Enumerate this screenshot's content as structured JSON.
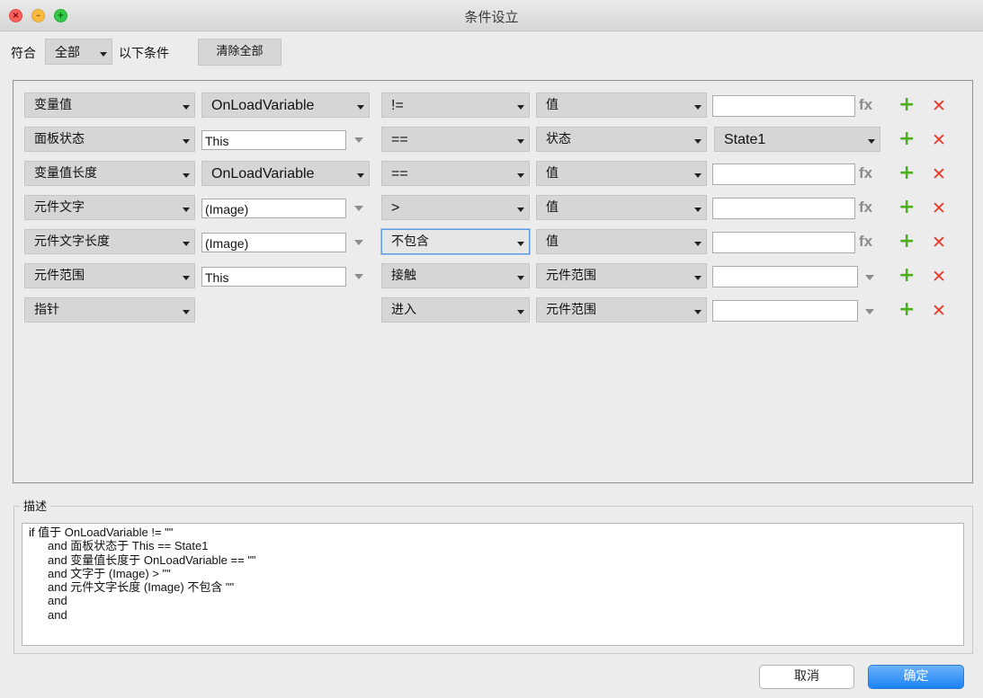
{
  "window": {
    "title": "条件设立"
  },
  "top": {
    "match_label": "符合",
    "match_value": "全部",
    "following_label": "以下条件",
    "clear_all": "清除全部"
  },
  "rows": [
    {
      "type": "变量值",
      "target": "OnLoadVariable",
      "op": "!=",
      "value_type": "值",
      "value": ""
    },
    {
      "type": "面板状态",
      "target": "This",
      "op": "==",
      "value_type": "状态",
      "value": "State1"
    },
    {
      "type": "变量值长度",
      "target": "OnLoadVariable",
      "op": "==",
      "value_type": "值",
      "value": ""
    },
    {
      "type": "元件文字",
      "target": "(Image)",
      "op": ">",
      "value_type": "值",
      "value": ""
    },
    {
      "type": "元件文字长度",
      "target": "(Image)",
      "op": "不包含",
      "value_type": "值",
      "value": ""
    },
    {
      "type": "元件范围",
      "target": "This",
      "op": "接触",
      "value_type": "元件范围",
      "value": ""
    },
    {
      "type": "指针",
      "target": "",
      "op": "进入",
      "value_type": "元件范围",
      "value": ""
    }
  ],
  "icons": {
    "fx": "fx",
    "plus": "+",
    "delete": "✕",
    "close": "×",
    "minimize": "–",
    "zoom": "+"
  },
  "description": {
    "label": "描述",
    "lines": [
      "if 值于 OnLoadVariable != \"\"",
      "and 面板状态于 This == State1",
      "and 变量值长度于 OnLoadVariable == \"\"",
      "and 文字于 (Image) > \"\"",
      "and 元件文字长度 (Image) 不包含 \"\"",
      "and",
      "and"
    ]
  },
  "buttons": {
    "cancel": "取消",
    "ok": "确定"
  },
  "colors": {
    "add": "#4caf1e",
    "delete": "#e8392c",
    "primary": "#1a82f7"
  }
}
